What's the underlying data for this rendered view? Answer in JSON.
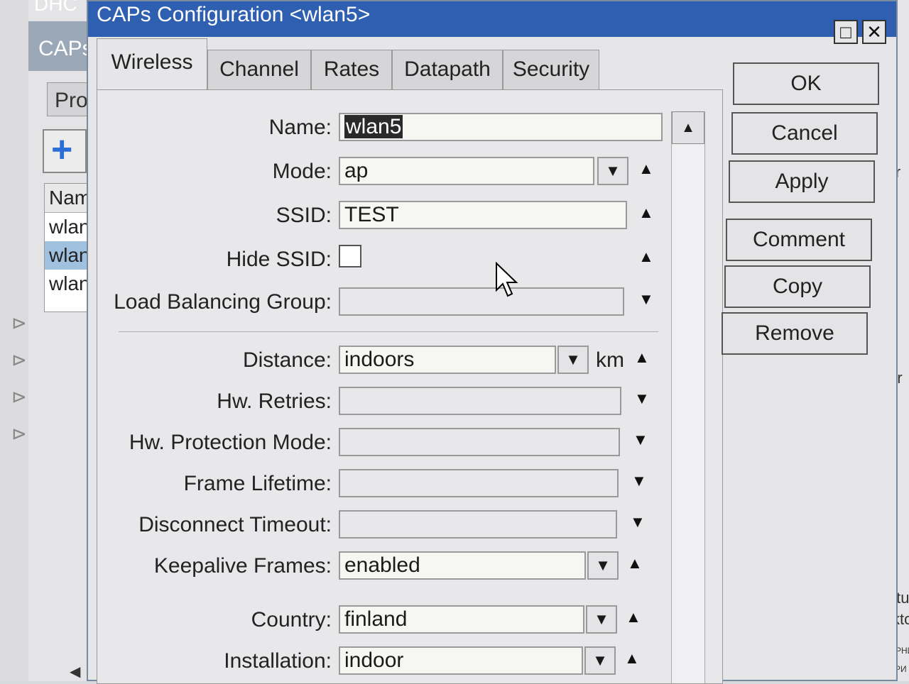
{
  "background": {
    "title_fragment": "DHC",
    "caps_fragment": "CAPs",
    "tab_fragment": "Pro",
    "list": [
      "Nam",
      "wlan",
      "wlan",
      "wlan"
    ],
    "right_fragments": [
      "re",
      "Cr",
      "ter",
      "intu-",
      "skto",
      "ЧЕРНИ",
      "КАРИ"
    ]
  },
  "dialog": {
    "title": "CAPs Configuration <wlan5>",
    "tabs": [
      {
        "label": "Wireless",
        "active": true
      },
      {
        "label": "Channel"
      },
      {
        "label": "Rates"
      },
      {
        "label": "Datapath"
      },
      {
        "label": "Security"
      }
    ],
    "fields": {
      "name": {
        "label": "Name:",
        "value": "wlan5"
      },
      "mode": {
        "label": "Mode:",
        "value": "ap"
      },
      "ssid": {
        "label": "SSID:",
        "value": "TEST"
      },
      "hide_ssid": {
        "label": "Hide SSID:",
        "checked": false
      },
      "load_balancing": {
        "label": "Load Balancing Group:",
        "value": ""
      },
      "distance": {
        "label": "Distance:",
        "value": "indoors",
        "unit": "km"
      },
      "hw_retries": {
        "label": "Hw. Retries:",
        "value": ""
      },
      "hw_protection": {
        "label": "Hw. Protection Mode:",
        "value": ""
      },
      "frame_lifetime": {
        "label": "Frame Lifetime:",
        "value": ""
      },
      "disconnect_timeout": {
        "label": "Disconnect Timeout:",
        "value": ""
      },
      "keepalive": {
        "label": "Keepalive Frames:",
        "value": "enabled"
      },
      "country": {
        "label": "Country:",
        "value": "finland"
      },
      "installation": {
        "label": "Installation:",
        "value": "indoor"
      }
    },
    "buttons": {
      "ok": "OK",
      "cancel": "Cancel",
      "apply": "Apply",
      "comment": "Comment",
      "copy": "Copy",
      "remove": "Remove"
    }
  }
}
